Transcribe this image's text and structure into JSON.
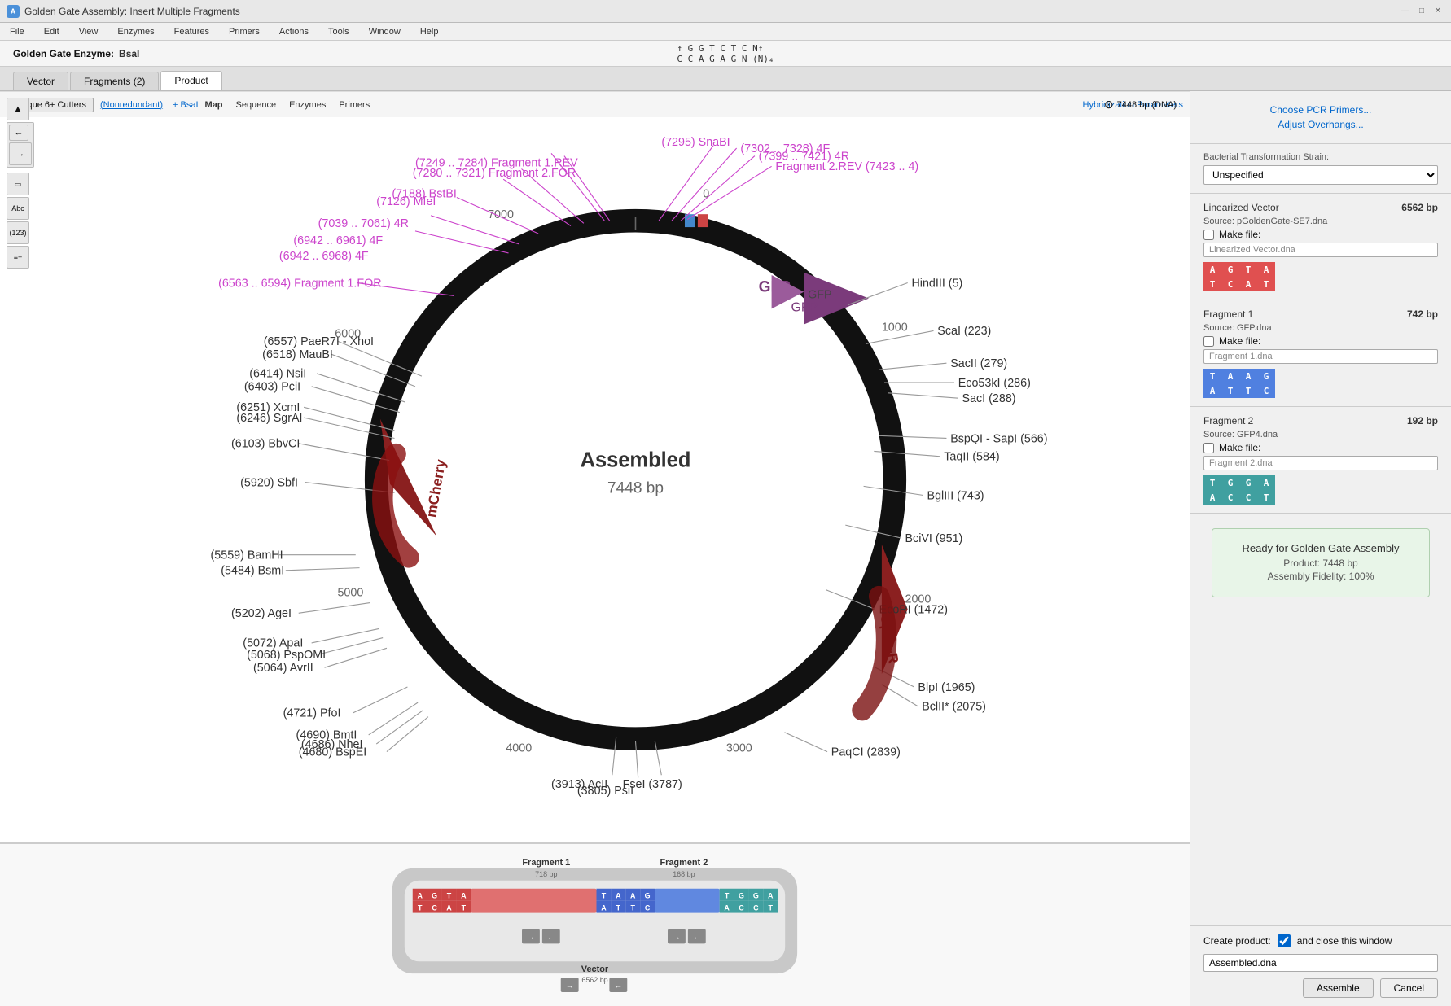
{
  "titleBar": {
    "icon": "A",
    "title": "Golden Gate Assembly: Insert Multiple Fragments",
    "controls": [
      "—",
      "□",
      "✕"
    ]
  },
  "menuBar": {
    "items": [
      "File",
      "Edit",
      "View",
      "Enzymes",
      "Features",
      "Primers",
      "Actions",
      "Tools",
      "Window",
      "Help"
    ]
  },
  "enzymeBar": {
    "label": "Golden Gate Enzyme:",
    "name": "BsaI",
    "sequence_top": "↑ G G T C T C N↑",
    "sequence_bot": "C C A G A G N (N)₄"
  },
  "tabs": [
    "Vector",
    "Fragments (2)",
    "Product"
  ],
  "activeTab": "Product",
  "mapInfo": {
    "size": "7448 bp (DNA)"
  },
  "plasmid": {
    "title": "Assembled",
    "size": "7448 bp",
    "features": [
      {
        "name": "GFP",
        "type": "arrow",
        "color": "#8B4B8B"
      },
      {
        "name": "mCherry",
        "type": "arrow",
        "color": "#8B2020"
      },
      {
        "name": "Spec-R",
        "type": "arrow",
        "color": "#8B2020"
      }
    ],
    "sites": [
      {
        "name": "HindIII",
        "pos": 5,
        "angle": 75
      },
      {
        "name": "ScaI",
        "pos": 223,
        "angle": 68
      },
      {
        "name": "SacII",
        "pos": 279,
        "angle": 65
      },
      {
        "name": "Eco53kI",
        "pos": 286,
        "angle": 62
      },
      {
        "name": "SacI",
        "pos": 288,
        "angle": 60
      },
      {
        "name": "BspQI - SapI",
        "pos": 566,
        "angle": 52
      },
      {
        "name": "TaqII",
        "pos": 584,
        "angle": 50
      },
      {
        "name": "BglIII",
        "pos": 743,
        "angle": 45
      },
      {
        "name": "BciVI",
        "pos": 951,
        "angle": 40
      },
      {
        "name": "EcoRI",
        "pos": 1472,
        "angle": 20
      },
      {
        "name": "BlpI",
        "pos": 1965,
        "angle": 355
      },
      {
        "name": "BclII*",
        "pos": 2075,
        "angle": 350
      },
      {
        "name": "PaqCI",
        "pos": 2839,
        "angle": 330
      },
      {
        "name": "FseI",
        "pos": 3787,
        "angle": 305
      },
      {
        "name": "PsiI",
        "pos": 3805,
        "angle": 303
      },
      {
        "name": "AcII",
        "pos": 3913,
        "angle": 300
      },
      {
        "name": "BspEI",
        "pos": 4680,
        "angle": 270
      },
      {
        "name": "NheI",
        "pos": 4686,
        "angle": 268
      },
      {
        "name": "BmtI",
        "pos": 4690,
        "angle": 266
      },
      {
        "name": "PfoI",
        "pos": 4721,
        "angle": 264
      },
      {
        "name": "AvrII",
        "pos": 5064,
        "angle": 255
      },
      {
        "name": "PspOMI",
        "pos": 5068,
        "angle": 253
      },
      {
        "name": "ApaI",
        "pos": 5072,
        "angle": 251
      },
      {
        "name": "AgeI",
        "pos": 5202,
        "angle": 246
      },
      {
        "name": "BsmI",
        "pos": 5484,
        "angle": 240
      },
      {
        "name": "BamHI",
        "pos": 5559,
        "angle": 238
      },
      {
        "name": "SbfI",
        "pos": 5920,
        "angle": 232
      },
      {
        "name": "BbvCI",
        "pos": 6103,
        "angle": 226
      },
      {
        "name": "SgrAI",
        "pos": 6246,
        "angle": 222
      },
      {
        "name": "XcmI",
        "pos": 6251,
        "angle": 220
      },
      {
        "name": "PciI",
        "pos": 6403,
        "angle": 215
      },
      {
        "name": "NsiI",
        "pos": 6414,
        "angle": 213
      },
      {
        "name": "MauBI",
        "pos": 6518,
        "angle": 210
      },
      {
        "name": "PaeR7I - XhoI",
        "pos": 6557,
        "angle": 208
      }
    ],
    "pinkLabels": [
      {
        "name": "Fragment 2.REV (7423 .. 4)",
        "angle": 80
      },
      {
        "name": "(7399 .. 7421) 4R",
        "angle": 83
      },
      {
        "name": "(7302 .. 7328) 4F",
        "angle": 86
      },
      {
        "name": "(7295) SnaBI",
        "angle": 89
      },
      {
        "name": "(7249 .. 7284) Fragment 1.REV",
        "angle": 95
      },
      {
        "name": "(7280 .. 7321) Fragment 2.FOR",
        "angle": 98
      },
      {
        "name": "(7188) BstBI",
        "angle": 104
      },
      {
        "name": "(7126) MfeI",
        "angle": 107
      },
      {
        "name": "(7039 .. 7061) 4R",
        "angle": 113
      },
      {
        "name": "(6942 .. 6961) 4F",
        "angle": 116
      },
      {
        "name": "(6942 .. 6968) 4F",
        "angle": 119
      },
      {
        "name": "(6563 .. 6594) Fragment 1.FOR",
        "angle": 125
      }
    ]
  },
  "mapTabs": [
    "Map",
    "Sequence",
    "Enzymes",
    "Primers"
  ],
  "activeMapTab": "Map",
  "cutterBtn": "Unique 6+ Cutters",
  "cutterLabel": "(Nonredundant)",
  "cutterExtra": "+ BsaI",
  "hybParams": "Hybridization Parameters",
  "rightPanel": {
    "choosePCR": "Choose PCR Primers...",
    "adjustOverhangs": "Adjust Overhangs...",
    "bacterialStrain": {
      "label": "Bacterial Transformation Strain:",
      "value": "Unspecified"
    },
    "linearizedVector": {
      "label": "Linearized Vector",
      "size": "6562 bp",
      "source": "Source:  pGoldenGate-SE7.dna",
      "makeFile": "Make file:",
      "fileName": "Linearized Vector.dna",
      "overhangTop": [
        "A",
        "G",
        "T",
        "A"
      ],
      "overhangBot": [
        "T",
        "C",
        "A",
        "T"
      ],
      "topColors": [
        "red",
        "red",
        "red",
        "red"
      ],
      "botColors": [
        "red",
        "red",
        "red",
        "red"
      ]
    },
    "fragment1": {
      "label": "Fragment 1",
      "size": "742 bp",
      "source": "Source:  GFP.dna",
      "makeFile": "Make file:",
      "fileName": "Fragment 1.dna",
      "overhangTop": [
        "T",
        "A",
        "A",
        "G"
      ],
      "overhangBot": [
        "A",
        "T",
        "T",
        "C"
      ],
      "topColors": [
        "blue",
        "blue",
        "blue",
        "blue"
      ],
      "botColors": [
        "blue",
        "blue",
        "blue",
        "blue"
      ]
    },
    "fragment2": {
      "label": "Fragment 2",
      "size": "192 bp",
      "source": "Source:  GFP4.dna",
      "makeFile": "Make file:",
      "fileName": "Fragment 2.dna",
      "overhangTop": [
        "T",
        "G",
        "G",
        "A"
      ],
      "overhangBot": [
        "A",
        "C",
        "C",
        "T"
      ],
      "topColors": [
        "teal",
        "teal",
        "teal",
        "teal"
      ],
      "botColors": [
        "teal",
        "teal",
        "teal",
        "teal"
      ]
    },
    "assembly": {
      "status": "Ready for Golden Gate Assembly",
      "product": "Product: 7448 bp",
      "fidelity": "Assembly Fidelity: 100%"
    },
    "createProduct": {
      "label": "Create product:",
      "checkboxChecked": true,
      "checkboxLabel": "and close this window",
      "fileName": "Assembled.dna"
    },
    "assembleBtn": "Assemble",
    "cancelBtn": "Cancel"
  },
  "bottomPanel": {
    "fragment1": {
      "label": "Fragment 1",
      "size": "718 bp",
      "overhangTop": [
        "A",
        "G",
        "T",
        "A"
      ],
      "overhangBot": [
        "T",
        "C",
        "A",
        "T"
      ],
      "overhang2Top": [
        "T",
        "A",
        "A",
        "G"
      ],
      "overhang2Bot": [
        "A",
        "T",
        "T",
        "C"
      ]
    },
    "fragment2": {
      "label": "Fragment 2",
      "size": "168 bp",
      "overhangTop": [
        "T",
        "A",
        "A",
        "G"
      ],
      "overhangBot": [
        "A",
        "T",
        "T",
        "C"
      ],
      "overhang2Top": [
        "T",
        "G",
        "G",
        "A"
      ],
      "overhang2Bot": [
        "A",
        "C",
        "C",
        "T"
      ]
    },
    "vector": {
      "label": "Vector",
      "size": "6562 bp"
    }
  }
}
